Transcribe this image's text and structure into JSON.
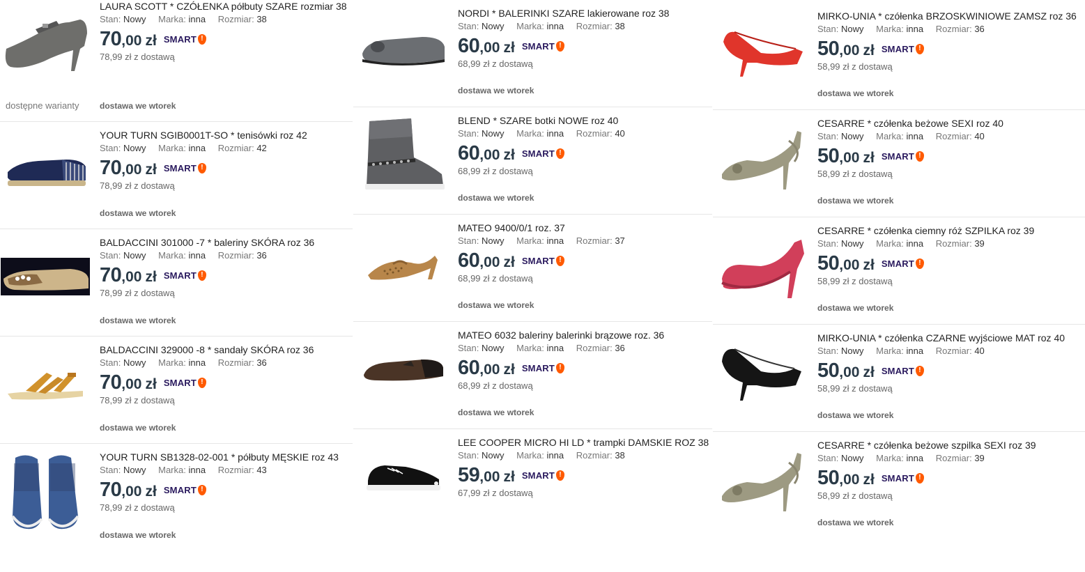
{
  "currency": "zł",
  "smart_label": "SMART",
  "labels": {
    "stan": "Stan:",
    "marka": "Marka:",
    "rozmiar": "Rozmiar:"
  },
  "columns": [
    {
      "items": [
        {
          "title": "LAURA SCOTT * CZÓŁENKA półbuty SZARE rozmiar 38",
          "stan": "Nowy",
          "marka": "inna",
          "rozmiar": "38",
          "price_int": "70",
          "price_dec": ",00",
          "with_delivery": "78,99 zł z dostawą",
          "delivery": "dostawa we wtorek",
          "variants": "dostępne warianty",
          "icon": "grey-mary-jane-heel-icon"
        },
        {
          "title": "YOUR TURN SGIB0001T-SO * tenisówki roz 42",
          "stan": "Nowy",
          "marka": "inna",
          "rozmiar": "42",
          "price_int": "70",
          "price_dec": ",00",
          "with_delivery": "78,99 zł z dostawą",
          "delivery": "dostawa we wtorek",
          "icon": "navy-espadrille-icon"
        },
        {
          "title": "BALDACCINI 301000 -7 * baleriny SKÓRA roz 36",
          "stan": "Nowy",
          "marka": "inna",
          "rozmiar": "36",
          "price_int": "70",
          "price_dec": ",00",
          "with_delivery": "78,99 zł z dostawą",
          "delivery": "dostawa we wtorek",
          "icon": "gold-ballerina-icon"
        },
        {
          "title": "BALDACCINI 329000 -8 * sandały SKÓRA roz 36",
          "stan": "Nowy",
          "marka": "inna",
          "rozmiar": "36",
          "price_int": "70",
          "price_dec": ",00",
          "with_delivery": "78,99 zł z dostawą",
          "delivery": "dostawa we wtorek",
          "icon": "tan-sandal-icon"
        },
        {
          "title": "YOUR TURN SB1328-02-001 * półbuty MĘSKIE roz 43",
          "stan": "Nowy",
          "marka": "inna",
          "rozmiar": "43",
          "price_int": "70",
          "price_dec": ",00",
          "with_delivery": "78,99 zł z dostawą",
          "delivery": "dostawa we wtorek",
          "icon": "blue-sneaker-pair-icon"
        }
      ]
    },
    {
      "items": [
        {
          "title": "NORDI * BALERINKI SZARE lakierowane roz 38",
          "stan": "Nowy",
          "marka": "inna",
          "rozmiar": "38",
          "price_int": "60",
          "price_dec": ",00",
          "with_delivery": "68,99 zł z dostawą",
          "delivery": "dostawa we wtorek",
          "icon": "grey-ballerina-icon"
        },
        {
          "title": "BLEND * SZARE botki NOWE roz 40",
          "stan": "Nowy",
          "marka": "inna",
          "rozmiar": "40",
          "price_int": "60",
          "price_dec": ",00",
          "with_delivery": "68,99 zł z dostawą",
          "delivery": "dostawa we wtorek",
          "icon": "grey-boot-icon"
        },
        {
          "title": "MATEO 9400/0/1 roz. 37",
          "stan": "Nowy",
          "marka": "inna",
          "rozmiar": "37",
          "price_int": "60",
          "price_dec": ",00",
          "with_delivery": "68,99 zł z dostawą",
          "delivery": "dostawa we wtorek",
          "icon": "tan-slingback-icon"
        },
        {
          "title": "MATEO 6032 baleriny balerinki brązowe roz. 36",
          "stan": "Nowy",
          "marka": "inna",
          "rozmiar": "36",
          "price_int": "60",
          "price_dec": ",00",
          "with_delivery": "68,99 zł z dostawą",
          "delivery": "dostawa we wtorek",
          "icon": "brown-ballerina-icon"
        },
        {
          "title": "LEE COOPER MICRO HI LD * trampki DAMSKIE ROZ 38",
          "stan": "Nowy",
          "marka": "inna",
          "rozmiar": "38",
          "price_int": "59",
          "price_dec": ",00",
          "with_delivery": "67,99 zł z dostawą",
          "delivery": "",
          "icon": "black-sneaker-icon"
        }
      ]
    },
    {
      "items": [
        {
          "title": "MIRKO-UNIA * czółenka BRZOSKWINIOWE ZAMSZ roz 36",
          "stan": "Nowy",
          "marka": "inna",
          "rozmiar": "36",
          "price_int": "50",
          "price_dec": ",00",
          "with_delivery": "58,99 zł z dostawą",
          "delivery": "dostawa we wtorek",
          "icon": "red-pump-icon"
        },
        {
          "title": "CESARRE * czółenka beżowe SEXI roz 40",
          "stan": "Nowy",
          "marka": "inna",
          "rozmiar": "40",
          "price_int": "50",
          "price_dec": ",00",
          "with_delivery": "58,99 zł z dostawą",
          "delivery": "dostawa we wtorek",
          "icon": "beige-slingback-heel-icon"
        },
        {
          "title": "CESARRE * czółenka ciemny róż SZPILKA roz 39",
          "stan": "Nowy",
          "marka": "inna",
          "rozmiar": "39",
          "price_int": "50",
          "price_dec": ",00",
          "with_delivery": "58,99 zł z dostawą",
          "delivery": "dostawa we wtorek",
          "icon": "pink-platform-pump-icon"
        },
        {
          "title": "MIRKO-UNIA * czółenka CZARNE wyjściowe MAT roz 40",
          "stan": "Nowy",
          "marka": "inna",
          "rozmiar": "40",
          "price_int": "50",
          "price_dec": ",00",
          "with_delivery": "58,99 zł z dostawą",
          "delivery": "dostawa we wtorek",
          "icon": "black-pump-icon"
        },
        {
          "title": "CESARRE * czółenka beżowe szpilka SEXI roz 39",
          "stan": "Nowy",
          "marka": "inna",
          "rozmiar": "39",
          "price_int": "50",
          "price_dec": ",00",
          "with_delivery": "58,99 zł z dostawą",
          "delivery": "dostawa we wtorek",
          "icon": "beige-slingback-heel-icon"
        }
      ]
    }
  ],
  "colors": {
    "price": "#2a3a47",
    "smart_text": "#2a1a5e",
    "smart_badge": "#ff5a00",
    "divider": "#e6e6e6"
  }
}
